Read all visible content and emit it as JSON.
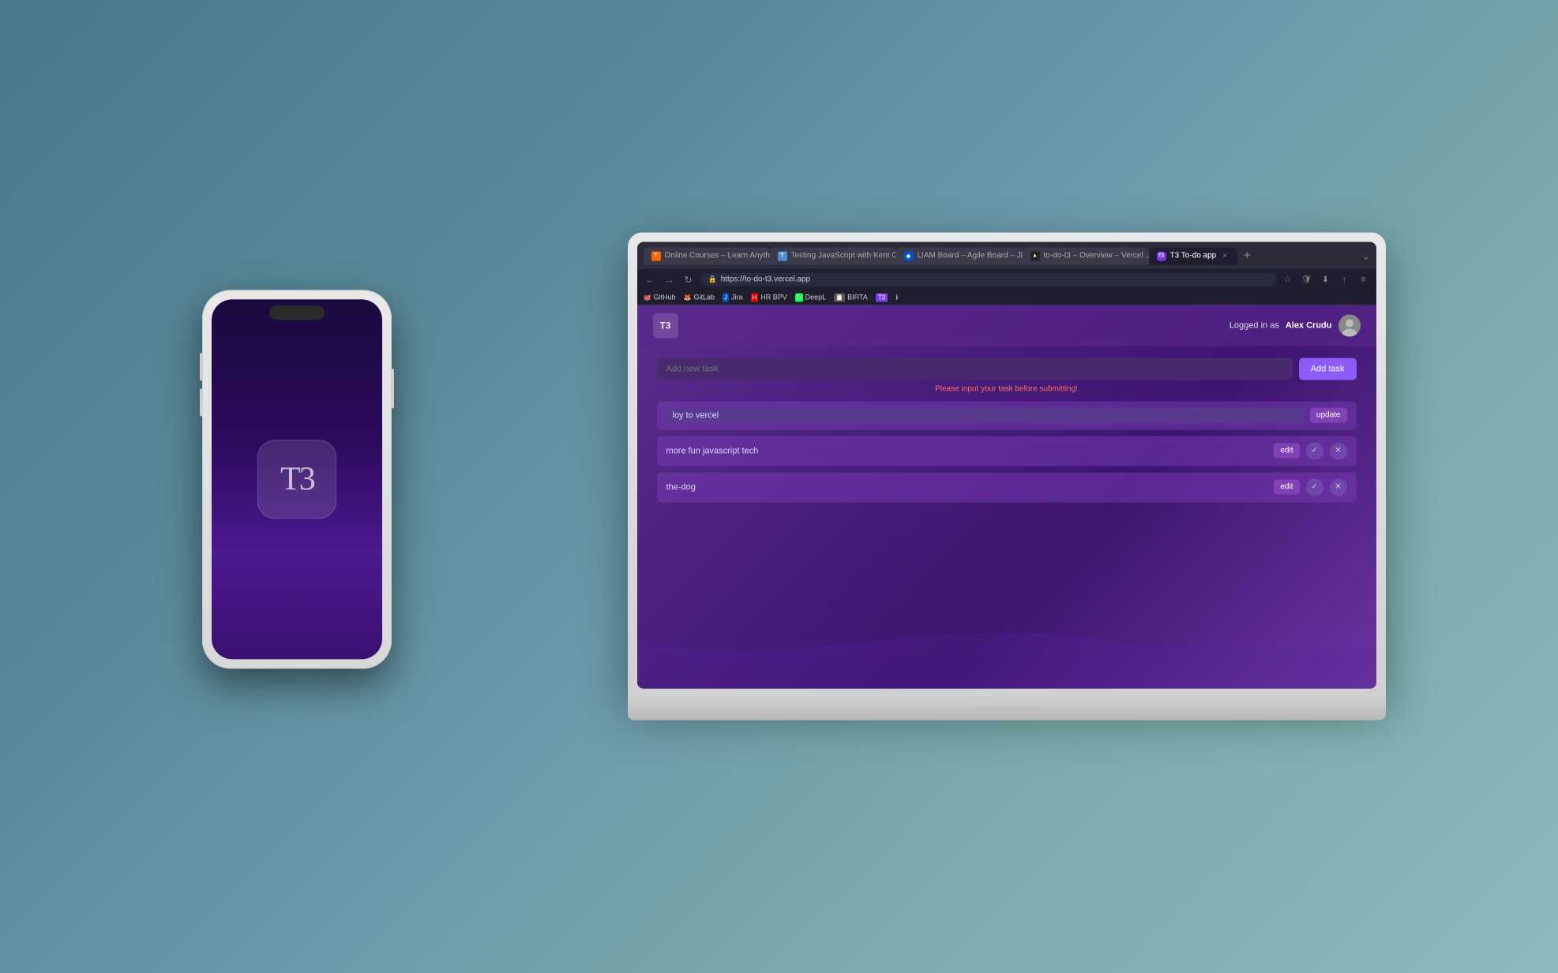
{
  "browser": {
    "tabs": [
      {
        "id": "tab-courses",
        "label": "Online Courses – Learn Anythi...",
        "favicon_color": "#ff6600",
        "favicon_text": "T",
        "active": false
      },
      {
        "id": "tab-testing",
        "label": "Testing JavaScript with Kent C...",
        "favicon_color": "#4444ff",
        "favicon_text": "T",
        "active": false
      },
      {
        "id": "tab-jira",
        "label": "LIAM Board – Agile Board – Jira ...",
        "favicon_color": "#0052cc",
        "favicon_text": "◆",
        "active": false
      },
      {
        "id": "tab-vercel",
        "label": "to-do-t3 – Overview – Vercel ...",
        "favicon_color": "#000",
        "favicon_text": "▲",
        "active": false
      },
      {
        "id": "tab-todo",
        "label": "T3 To-do app",
        "favicon_color": "#7c3aed",
        "favicon_text": "T3",
        "active": true
      }
    ],
    "url": "https://to-do-t3.vercel.app",
    "bookmarks": [
      {
        "label": "GitHub",
        "favicon": "🐙"
      },
      {
        "label": "GitLab",
        "favicon": "🦊"
      },
      {
        "label": "Jira",
        "favicon": "J"
      },
      {
        "label": "HR BPV",
        "favicon": ""
      },
      {
        "label": "DeepL",
        "favicon": ""
      },
      {
        "label": "BIRTA",
        "favicon": ""
      },
      {
        "label": "T3",
        "favicon": ""
      }
    ]
  },
  "app": {
    "logo_text": "T3",
    "logged_in_prefix": "Logged in as",
    "username": "Alex Crudu",
    "task_input_placeholder": "Add new task",
    "add_task_button": "Add task",
    "error_message": "Please input your task before submitting!",
    "tasks": [
      {
        "id": "task-1",
        "text": "loy to vercel",
        "editing": true,
        "actions": [
          "update"
        ]
      },
      {
        "id": "task-2",
        "text": "more fun javascript tech",
        "editing": false,
        "actions": [
          "edit",
          "check",
          "x"
        ]
      },
      {
        "id": "task-3",
        "text": "the-dog",
        "editing": false,
        "actions": [
          "edit",
          "check",
          "x"
        ]
      }
    ]
  },
  "phone": {
    "app_icon_text": "T3"
  },
  "icons": {
    "back": "←",
    "forward": "→",
    "reload": "↻",
    "lock": "🔒",
    "star": "☆",
    "new_tab": "+",
    "menu": "≡",
    "shield": "🛡",
    "download": "⬇",
    "share": "↑",
    "check": "✓",
    "close": "✕"
  }
}
